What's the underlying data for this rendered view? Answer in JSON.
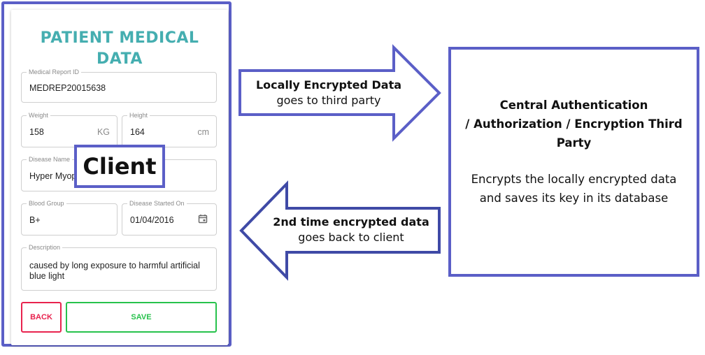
{
  "client_form": {
    "title_line1": "PATIENT MEDICAL",
    "title_line2": "DATA",
    "medical_report_id": {
      "label": "Medical Report ID",
      "value": "MEDREP20015638"
    },
    "weight": {
      "label": "Weight",
      "value": "158",
      "unit": "KG"
    },
    "height": {
      "label": "Height",
      "value": "164",
      "unit": "cm"
    },
    "disease_name": {
      "label": "Disease Name",
      "value": "Hyper Myopia"
    },
    "blood_group": {
      "label": "Blood Group",
      "value": "B+"
    },
    "disease_started_on": {
      "label": "Disease Started On",
      "value": "01/04/2016"
    },
    "description": {
      "label": "Description",
      "value": "caused by long exposure to harmful artificial blue light"
    },
    "back_label": "BACK",
    "save_label": "SAVE"
  },
  "client_label": "Client",
  "arrow_forward": {
    "bold": "Locally Encrypted Data",
    "normal": "goes to third party"
  },
  "arrow_back": {
    "bold": "2nd time encrypted data",
    "normal": "goes back to client"
  },
  "third_party": {
    "title_line1": "Central Authentication",
    "title_line2": "/ Authorization / Encryption Third",
    "title_line3": "Party",
    "desc_line1": "Encrypts the locally encrypted data",
    "desc_line2": "and saves its key in its database"
  },
  "colors": {
    "frame": "#5b5fc7",
    "title": "#45aeb0",
    "back": "#e8234e",
    "save": "#27c24c"
  }
}
